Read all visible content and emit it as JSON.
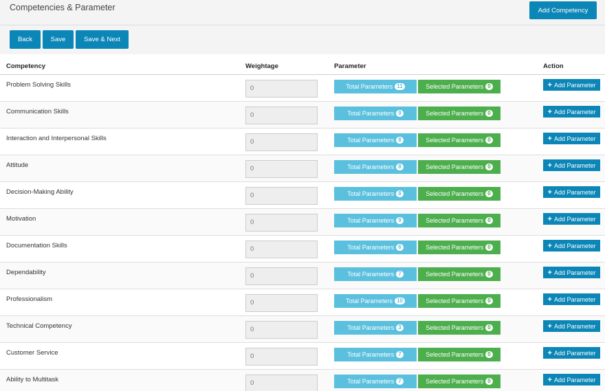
{
  "header": {
    "title": "Competencies & Parameter",
    "add_competency_label": "Add Competency"
  },
  "toolbar": {
    "back_label": "Back",
    "save_label": "Save",
    "save_next_label": "Save & Next"
  },
  "table": {
    "columns": [
      "Competency",
      "Weightage",
      "Parameter",
      "Action"
    ],
    "total_label": "Total Parameters",
    "selected_label": "Selected Parameters",
    "add_param_label": "Add Parameter",
    "rows": [
      {
        "name": "Problem Solving Skills",
        "weightage": "0",
        "total": "11",
        "selected": "0"
      },
      {
        "name": "Communication Skills",
        "weightage": "0",
        "total": "9",
        "selected": "0"
      },
      {
        "name": "Interaction and Interpersonal Skills",
        "weightage": "0",
        "total": "8",
        "selected": "0"
      },
      {
        "name": "Attitude",
        "weightage": "0",
        "total": "8",
        "selected": "0"
      },
      {
        "name": "Decision-Making Ability",
        "weightage": "0",
        "total": "8",
        "selected": "0"
      },
      {
        "name": "Motivation",
        "weightage": "0",
        "total": "9",
        "selected": "0"
      },
      {
        "name": "Documentation Skills",
        "weightage": "0",
        "total": "6",
        "selected": "0"
      },
      {
        "name": "Dependability",
        "weightage": "0",
        "total": "7",
        "selected": "0"
      },
      {
        "name": "Professionalism",
        "weightage": "0",
        "total": "10",
        "selected": "0"
      },
      {
        "name": "Technical Competency",
        "weightage": "0",
        "total": "3",
        "selected": "0"
      },
      {
        "name": "Customer Service",
        "weightage": "0",
        "total": "7",
        "selected": "0"
      },
      {
        "name": "Ability to Multitask",
        "weightage": "0",
        "total": "7",
        "selected": "0"
      }
    ]
  },
  "colors": {
    "primary": "#0b86b7",
    "info": "#5bc0de",
    "success": "#4cae4c"
  }
}
